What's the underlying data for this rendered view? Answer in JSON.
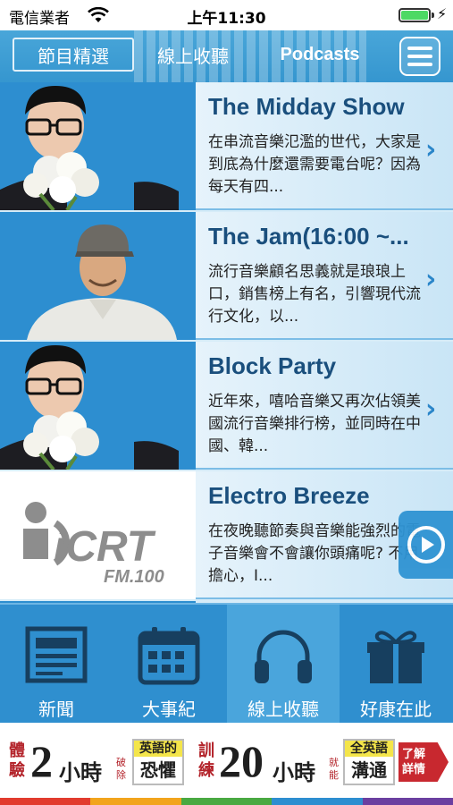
{
  "status_bar": {
    "carrier": "電信業者",
    "time": "上午11:30"
  },
  "top_nav": {
    "tabs": [
      {
        "label": "節目精選",
        "active": true
      },
      {
        "label": "線上收聽",
        "active": false
      },
      {
        "label": "Podcasts",
        "active": false
      }
    ],
    "menu_icon": "hamburger-icon"
  },
  "programs": [
    {
      "title": "The Midday Show",
      "description": "在串流音樂氾濫的世代，大家是到底為什麼還需要電台呢？因為每天有四...",
      "thumbnail": "host-with-flowers"
    },
    {
      "title": "The Jam(16:00 ~...",
      "description": "流行音樂顧名思義就是琅琅上口，銷售榜上有名，引響現代流行文化，以...",
      "thumbnail": "host-with-cap"
    },
    {
      "title": "Block Party",
      "description": "近年來，嘻哈音樂又再次佔領美國流行音樂排行榜，並同時在中國、韓...",
      "thumbnail": "host-with-flowers"
    },
    {
      "title": "Electro Breeze",
      "description": "在夜晚聽節奏與音樂能強烈的電子音樂會不會讓你頭痛呢? 不用擔心，I...",
      "thumbnail": "icrt-logo"
    }
  ],
  "logo": {
    "brand": "iCRT",
    "sub": "FM.100"
  },
  "bottom_tabs": [
    {
      "label": "新聞",
      "icon": "newspaper-icon",
      "active": false
    },
    {
      "label": "大事紀",
      "icon": "calendar-icon",
      "active": false
    },
    {
      "label": "線上收聽",
      "icon": "headphones-icon",
      "active": true
    },
    {
      "label": "好康在此",
      "icon": "gift-icon",
      "active": false
    }
  ],
  "ad": {
    "left_small_top": "體",
    "left_small_bottom": "驗",
    "big1": "2",
    "unit1": "小時",
    "tiny1_top": "破",
    "tiny1_bottom": "除",
    "box1_top": "英語的",
    "box1_bottom": "恐懼",
    "mid_small_top": "訓",
    "mid_small_bottom": "練",
    "big2": "20",
    "unit2": "小時",
    "tiny2_top": "就",
    "tiny2_bottom": "能",
    "box2_top": "全英語",
    "box2_bottom": "溝通",
    "cta_top": "了解",
    "cta_bottom": "詳情",
    "stripe_colors": [
      "#e23b2e",
      "#f2a41c",
      "#49a942",
      "#2d8ed0",
      "#6b3fa0"
    ]
  },
  "colors": {
    "primary": "#2f8fcf",
    "title": "#1a4f7d",
    "accent_ad": "#b3232a"
  }
}
